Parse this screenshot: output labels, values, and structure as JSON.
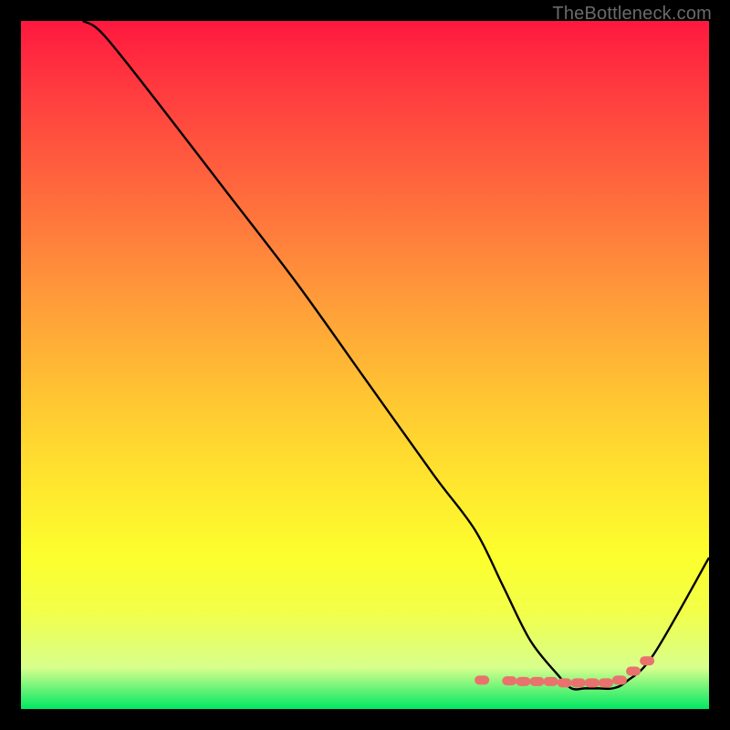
{
  "attribution": "TheBottleneck.com",
  "chart_data": {
    "type": "line",
    "title": "",
    "xlabel": "",
    "ylabel": "",
    "xlim": [
      0,
      100
    ],
    "ylim": [
      0,
      100
    ],
    "series": [
      {
        "name": "curve",
        "x": [
          9,
          12,
          20,
          30,
          40,
          50,
          60,
          66,
          70,
          74,
          78,
          80,
          82,
          84,
          86,
          88,
          92,
          100
        ],
        "values": [
          100,
          98,
          88,
          75,
          62,
          48,
          34,
          26,
          18,
          10,
          5,
          3,
          3,
          3,
          3,
          4,
          8,
          22
        ]
      },
      {
        "name": "highlight-dots",
        "x": [
          67,
          71,
          73,
          75,
          77,
          79,
          81,
          83,
          85,
          87,
          89,
          91
        ],
        "values": [
          4.2,
          4.1,
          4,
          4,
          4,
          3.8,
          3.8,
          3.8,
          3.8,
          4.2,
          5.5,
          7
        ]
      }
    ]
  }
}
